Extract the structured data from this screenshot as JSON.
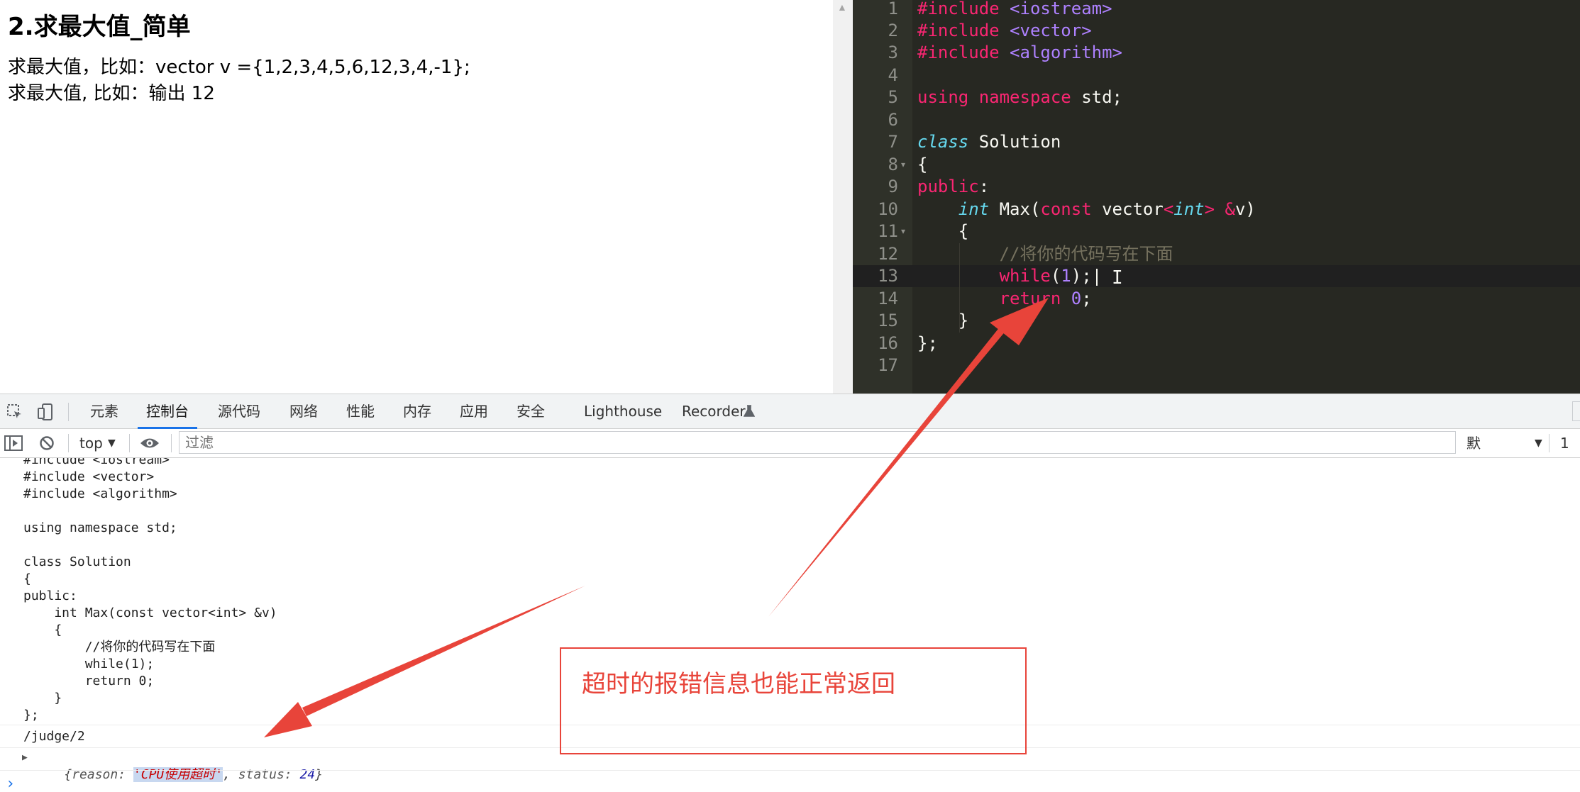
{
  "problem": {
    "title": "2.求最大值_简单",
    "line1": "求最大值，比如：vector v ={1,2,3,4,5,6,12,3,4,-1};",
    "line2": "求最大值, 比如：输出 12"
  },
  "editor": {
    "line_numbers": [
      "1",
      "2",
      "3",
      "4",
      "5",
      "6",
      "7",
      "8",
      "9",
      "10",
      "11",
      "12",
      "13",
      "14",
      "15",
      "16",
      "17"
    ],
    "lines": {
      "l1_kw": "#include",
      "l1_str": "<iostream>",
      "l2_kw": "#include",
      "l2_str": "<vector>",
      "l3_kw": "#include",
      "l3_str": "<algorithm>",
      "l5_kw1": "using",
      "l5_kw2": "namespace",
      "l5_rest": "std;",
      "l7_kw": "class",
      "l7_rest": "Solution",
      "l8": "{",
      "l9_kw": "public",
      "l9_rest": ":",
      "l10_type": "int",
      "l10_a": "Max(",
      "l10_const": "const",
      "l10_b": "vector",
      "l10_lt": "<",
      "l10_int": "int",
      "l10_gt": ">",
      "l10_amp": "&",
      "l10_c": "v)",
      "l11": "{",
      "l12_comment": "//将你的代码写在下面",
      "l13_kw": "while",
      "l13_a": "(",
      "l13_num": "1",
      "l13_b": ");",
      "l14_kw": "return",
      "l14_num": "0",
      "l14_b": ";",
      "l15": "}",
      "l16": "};"
    }
  },
  "devtools": {
    "tabs": [
      "元素",
      "控制台",
      "源代码",
      "网络",
      "性能",
      "内存",
      "应用",
      "安全",
      "Lighthouse",
      "Recorder"
    ],
    "context": "top",
    "filter_placeholder": "过滤",
    "level": "默认级别",
    "issues_count": "1"
  },
  "console": {
    "code_lines": [
      "#include <iostream>",
      "#include <vector>",
      "#include <algorithm>",
      "",
      "using namespace std;",
      "",
      "class Solution",
      "{",
      "public:",
      "    int Max(const vector<int> &v)",
      "    {",
      "        //将你的代码写在下面",
      "        while(1);",
      "        return 0;",
      "    }",
      "};"
    ],
    "url_line": "/judge/2",
    "object": {
      "open": "{",
      "reason_key": "reason: ",
      "reason_value": "'CPU使用超时'",
      "sep": ", ",
      "status_key": "status: ",
      "status_value": "24",
      "close": "}"
    }
  },
  "annotation": {
    "text": "超时的报错信息也能正常返回",
    "color": "#e8443a"
  },
  "colors": {
    "editor_bg": "#272822",
    "keyword": "#f92672",
    "string": "#ae81ff",
    "type": "#66d9ef",
    "comment": "#75715e",
    "accent": "#1a73e8"
  }
}
